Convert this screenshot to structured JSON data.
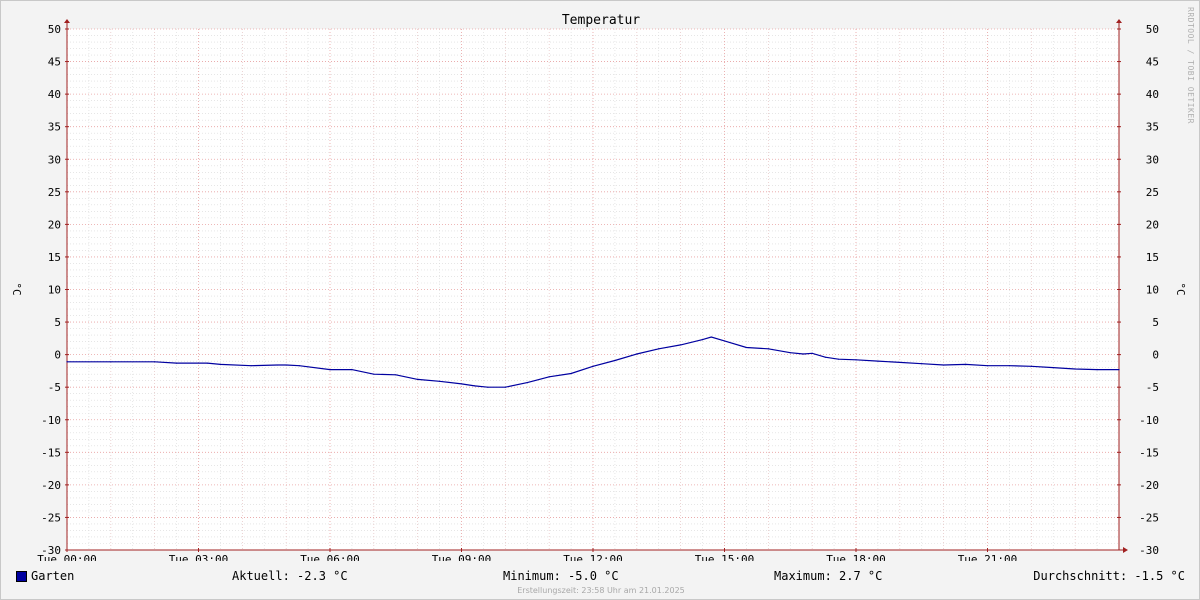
{
  "chart_data": {
    "type": "line",
    "title": "Temperatur",
    "ylabel": "°C",
    "ylabel_right": "°C",
    "ylim": [
      -30,
      50
    ],
    "yticks": [
      50,
      45,
      40,
      35,
      30,
      25,
      20,
      15,
      10,
      5,
      0,
      -5,
      -10,
      -15,
      -20,
      -25,
      -30
    ],
    "xlim": [
      0,
      24
    ],
    "xticks": [
      {
        "h": 0,
        "label": "Tue 00:00"
      },
      {
        "h": 3,
        "label": "Tue 03:00"
      },
      {
        "h": 6,
        "label": "Tue 06:00"
      },
      {
        "h": 9,
        "label": "Tue 09:00"
      },
      {
        "h": 12,
        "label": "Tue 12:00"
      },
      {
        "h": 15,
        "label": "Tue 15:00"
      },
      {
        "h": 18,
        "label": "Tue 18:00"
      },
      {
        "h": 21,
        "label": "Tue 21:00"
      }
    ],
    "grid": true,
    "series": [
      {
        "name": "Garten",
        "color": "#0000a0",
        "x": [
          0,
          1,
          2,
          2.5,
          3.2,
          3.5,
          4.2,
          4.8,
          5,
          5.3,
          6,
          6.5,
          7,
          7.5,
          8,
          8.5,
          9,
          9.3,
          9.6,
          10,
          10.5,
          11,
          11.5,
          12,
          12.5,
          13,
          13.5,
          14,
          14.5,
          14.7,
          15,
          15.5,
          16,
          16.5,
          16.8,
          17,
          17.3,
          17.6,
          18,
          18.5,
          19,
          19.5,
          20,
          20.5,
          21,
          21.5,
          22,
          22.5,
          23,
          23.5,
          24
        ],
        "y": [
          -1.1,
          -1.1,
          -1.1,
          -1.3,
          -1.3,
          -1.5,
          -1.7,
          -1.6,
          -1.6,
          -1.7,
          -2.3,
          -2.3,
          -3.0,
          -3.1,
          -3.8,
          -4.1,
          -4.5,
          -4.8,
          -5.0,
          -5.0,
          -4.3,
          -3.4,
          -2.9,
          -1.8,
          -0.9,
          0.1,
          0.9,
          1.5,
          2.3,
          2.7,
          2.1,
          1.1,
          0.9,
          0.3,
          0.1,
          0.2,
          -0.4,
          -0.7,
          -0.8,
          -1.0,
          -1.2,
          -1.4,
          -1.6,
          -1.5,
          -1.7,
          -1.7,
          -1.8,
          -2.0,
          -2.2,
          -2.3,
          -2.3
        ]
      }
    ]
  },
  "legend": {
    "series_label": "Garten",
    "aktuell": "Aktuell: -2.3 °C",
    "minimum": "Minimum: -5.0 °C",
    "maximum": "Maximum: 2.7 °C",
    "durchschnitt": "Durchschnitt: -1.5 °C"
  },
  "footer": "Erstellungszeit: 23:58 Uhr am 21.01.2025",
  "watermark": "RRDTOOL / TOBI OETIKER"
}
